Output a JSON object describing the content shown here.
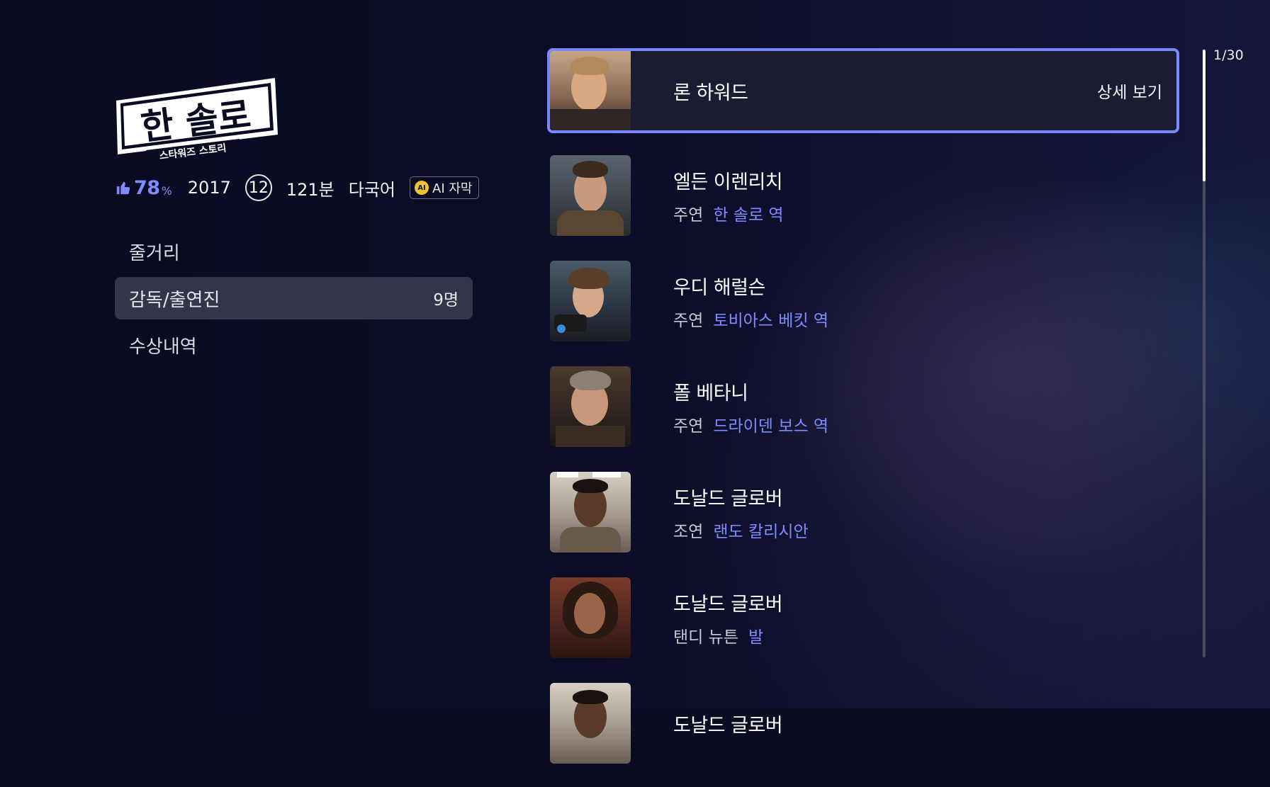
{
  "movie": {
    "logo_title": "한 솔로",
    "logo_subtitle": "스타워즈 스토리",
    "rating_value": "78",
    "rating_unit": "%",
    "year": "2017",
    "age_rating": "12",
    "runtime": "121분",
    "language": "다국어",
    "ai_badge_icon": "AI",
    "ai_badge": "AI 자막"
  },
  "menu": {
    "items": [
      {
        "label": "줄거리",
        "count": ""
      },
      {
        "label": "감독/출연진",
        "count": "9명"
      },
      {
        "label": "수상내역",
        "count": ""
      }
    ]
  },
  "cast": {
    "detail_label": "상세 보기",
    "items": [
      {
        "name": "론 하워드",
        "kind": "",
        "role": ""
      },
      {
        "name": "엘든 이렌리치",
        "kind": "주연",
        "role": "한 솔로 역"
      },
      {
        "name": "우디 해럴슨",
        "kind": "주연",
        "role": "토비아스 베킷 역"
      },
      {
        "name": "폴 베타니",
        "kind": "주연",
        "role": "드라이덴 보스 역"
      },
      {
        "name": "도날드 글로버",
        "kind": "조연",
        "role": "랜도 칼리시안"
      },
      {
        "name": "도날드 글로버",
        "kind": "탠디 뉴튼",
        "role": "발"
      },
      {
        "name": "도날드 글로버",
        "kind": "",
        "role": ""
      }
    ]
  },
  "pager": {
    "current": "1",
    "total": "30"
  },
  "colors": {
    "accent": "#7b87ff",
    "background": "#0b0c24",
    "active_menu": "#34354a"
  },
  "icons": {
    "rating": "thumbs-up-icon",
    "ai": "ai-icon"
  }
}
